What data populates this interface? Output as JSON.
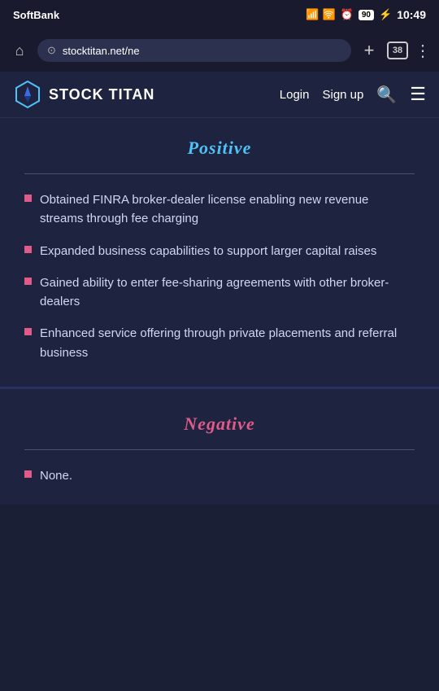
{
  "statusBar": {
    "carrier": "SoftBank",
    "alarm_icon": "⏰",
    "battery_label": "90",
    "time": "10:49"
  },
  "browserBar": {
    "url": "stocktitan.net/ne",
    "tab_count": "38",
    "home_icon": "⌂",
    "plus_icon": "+",
    "menu_icon": "⋮"
  },
  "siteHeader": {
    "logo_text": "STOCK TITAN",
    "nav_login": "Login",
    "nav_signup": "Sign up"
  },
  "positive": {
    "title": "Positive",
    "items": [
      "Obtained FINRA broker-dealer license enabling new revenue streams through fee charging",
      "Expanded business capabilities to support larger capital raises",
      "Gained ability to enter fee-sharing agreements with other broker-dealers",
      "Enhanced service offering through private placements and referral business"
    ]
  },
  "negative": {
    "title": "Negative",
    "items": [
      "None."
    ]
  }
}
